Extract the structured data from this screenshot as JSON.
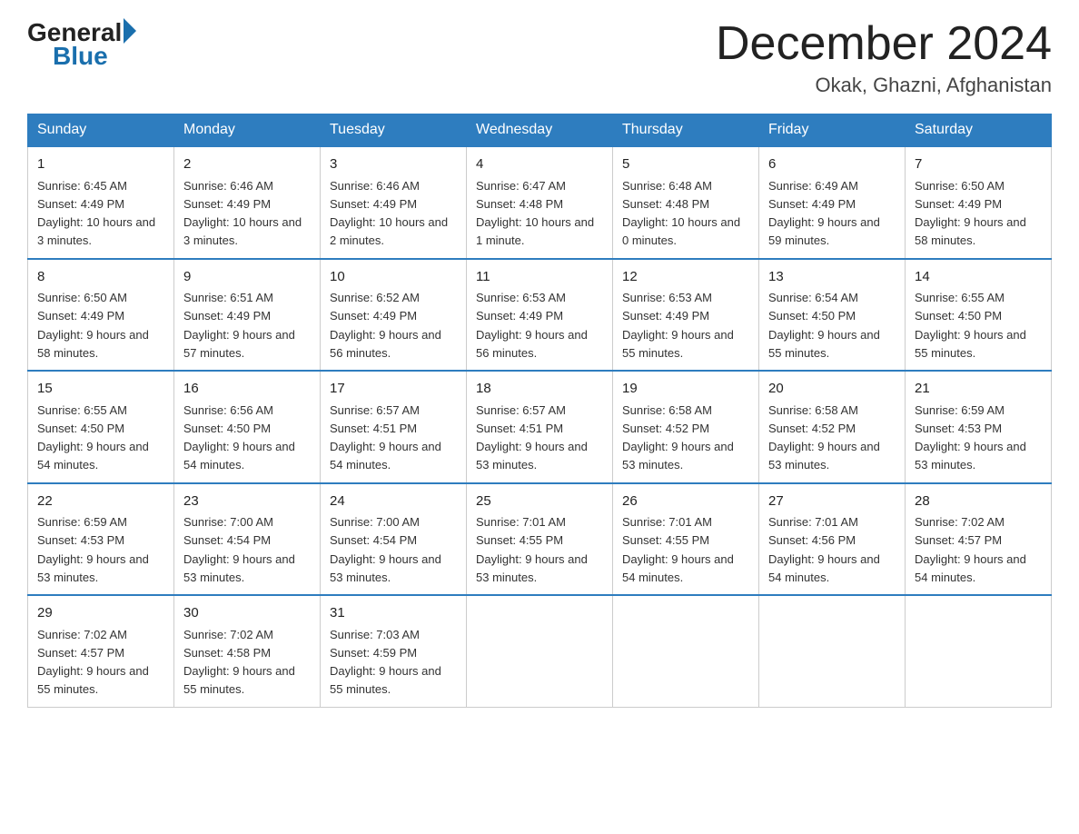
{
  "header": {
    "logo_general": "General",
    "logo_blue": "Blue",
    "month_title": "December 2024",
    "location": "Okak, Ghazni, Afghanistan"
  },
  "days_of_week": [
    "Sunday",
    "Monday",
    "Tuesday",
    "Wednesday",
    "Thursday",
    "Friday",
    "Saturday"
  ],
  "weeks": [
    [
      {
        "day": "1",
        "sunrise": "6:45 AM",
        "sunset": "4:49 PM",
        "daylight": "10 hours and 3 minutes."
      },
      {
        "day": "2",
        "sunrise": "6:46 AM",
        "sunset": "4:49 PM",
        "daylight": "10 hours and 3 minutes."
      },
      {
        "day": "3",
        "sunrise": "6:46 AM",
        "sunset": "4:49 PM",
        "daylight": "10 hours and 2 minutes."
      },
      {
        "day": "4",
        "sunrise": "6:47 AM",
        "sunset": "4:48 PM",
        "daylight": "10 hours and 1 minute."
      },
      {
        "day": "5",
        "sunrise": "6:48 AM",
        "sunset": "4:48 PM",
        "daylight": "10 hours and 0 minutes."
      },
      {
        "day": "6",
        "sunrise": "6:49 AM",
        "sunset": "4:49 PM",
        "daylight": "9 hours and 59 minutes."
      },
      {
        "day": "7",
        "sunrise": "6:50 AM",
        "sunset": "4:49 PM",
        "daylight": "9 hours and 58 minutes."
      }
    ],
    [
      {
        "day": "8",
        "sunrise": "6:50 AM",
        "sunset": "4:49 PM",
        "daylight": "9 hours and 58 minutes."
      },
      {
        "day": "9",
        "sunrise": "6:51 AM",
        "sunset": "4:49 PM",
        "daylight": "9 hours and 57 minutes."
      },
      {
        "day": "10",
        "sunrise": "6:52 AM",
        "sunset": "4:49 PM",
        "daylight": "9 hours and 56 minutes."
      },
      {
        "day": "11",
        "sunrise": "6:53 AM",
        "sunset": "4:49 PM",
        "daylight": "9 hours and 56 minutes."
      },
      {
        "day": "12",
        "sunrise": "6:53 AM",
        "sunset": "4:49 PM",
        "daylight": "9 hours and 55 minutes."
      },
      {
        "day": "13",
        "sunrise": "6:54 AM",
        "sunset": "4:50 PM",
        "daylight": "9 hours and 55 minutes."
      },
      {
        "day": "14",
        "sunrise": "6:55 AM",
        "sunset": "4:50 PM",
        "daylight": "9 hours and 55 minutes."
      }
    ],
    [
      {
        "day": "15",
        "sunrise": "6:55 AM",
        "sunset": "4:50 PM",
        "daylight": "9 hours and 54 minutes."
      },
      {
        "day": "16",
        "sunrise": "6:56 AM",
        "sunset": "4:50 PM",
        "daylight": "9 hours and 54 minutes."
      },
      {
        "day": "17",
        "sunrise": "6:57 AM",
        "sunset": "4:51 PM",
        "daylight": "9 hours and 54 minutes."
      },
      {
        "day": "18",
        "sunrise": "6:57 AM",
        "sunset": "4:51 PM",
        "daylight": "9 hours and 53 minutes."
      },
      {
        "day": "19",
        "sunrise": "6:58 AM",
        "sunset": "4:52 PM",
        "daylight": "9 hours and 53 minutes."
      },
      {
        "day": "20",
        "sunrise": "6:58 AM",
        "sunset": "4:52 PM",
        "daylight": "9 hours and 53 minutes."
      },
      {
        "day": "21",
        "sunrise": "6:59 AM",
        "sunset": "4:53 PM",
        "daylight": "9 hours and 53 minutes."
      }
    ],
    [
      {
        "day": "22",
        "sunrise": "6:59 AM",
        "sunset": "4:53 PM",
        "daylight": "9 hours and 53 minutes."
      },
      {
        "day": "23",
        "sunrise": "7:00 AM",
        "sunset": "4:54 PM",
        "daylight": "9 hours and 53 minutes."
      },
      {
        "day": "24",
        "sunrise": "7:00 AM",
        "sunset": "4:54 PM",
        "daylight": "9 hours and 53 minutes."
      },
      {
        "day": "25",
        "sunrise": "7:01 AM",
        "sunset": "4:55 PM",
        "daylight": "9 hours and 53 minutes."
      },
      {
        "day": "26",
        "sunrise": "7:01 AM",
        "sunset": "4:55 PM",
        "daylight": "9 hours and 54 minutes."
      },
      {
        "day": "27",
        "sunrise": "7:01 AM",
        "sunset": "4:56 PM",
        "daylight": "9 hours and 54 minutes."
      },
      {
        "day": "28",
        "sunrise": "7:02 AM",
        "sunset": "4:57 PM",
        "daylight": "9 hours and 54 minutes."
      }
    ],
    [
      {
        "day": "29",
        "sunrise": "7:02 AM",
        "sunset": "4:57 PM",
        "daylight": "9 hours and 55 minutes."
      },
      {
        "day": "30",
        "sunrise": "7:02 AM",
        "sunset": "4:58 PM",
        "daylight": "9 hours and 55 minutes."
      },
      {
        "day": "31",
        "sunrise": "7:03 AM",
        "sunset": "4:59 PM",
        "daylight": "9 hours and 55 minutes."
      },
      null,
      null,
      null,
      null
    ]
  ]
}
